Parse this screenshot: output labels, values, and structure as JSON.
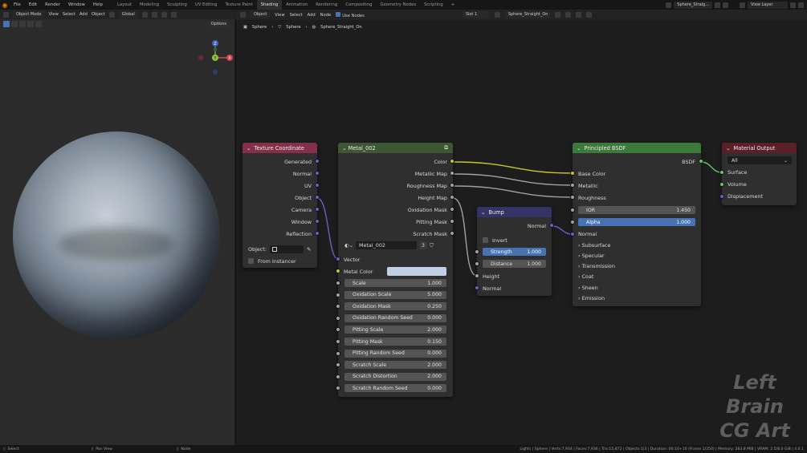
{
  "topbar": {
    "menus": [
      "File",
      "Edit",
      "Render",
      "Window",
      "Help"
    ],
    "workspaces": [
      "Layout",
      "Modeling",
      "Sculpting",
      "UV Editing",
      "Texture Paint",
      "Shading",
      "Animation",
      "Rendering",
      "Compositing",
      "Geometry Nodes",
      "Scripting"
    ],
    "active_workspace": "Shading",
    "plus": "+",
    "scene_name": "Sphere_Straig...",
    "view_layer": "View Layer"
  },
  "viewport": {
    "mode": "Object Mode",
    "menus": [
      "View",
      "Select",
      "Add",
      "Object"
    ],
    "transform": "Global",
    "options": "Options",
    "gizmo": {
      "z": "Z",
      "y": "Y",
      "x": "X"
    }
  },
  "node_editor": {
    "type": "Object",
    "menus": [
      "View",
      "Select",
      "Add",
      "Node"
    ],
    "use_nodes": "Use Nodes",
    "slot": "Slot 1",
    "material": "Sphere_Straight_On",
    "breadcrumb": [
      "Sphere",
      "Sphere",
      "Sphere_Straight_On"
    ]
  },
  "nodes": {
    "texcoord": {
      "title": "Texture Coordinate",
      "outputs": [
        "Generated",
        "Normal",
        "UV",
        "Object",
        "Camera",
        "Window",
        "Reflection"
      ],
      "object_label": "Object:",
      "from_instancer": "From Instancer"
    },
    "metal": {
      "title": "Metal_002",
      "outputs": [
        "Color",
        "Metallic Map",
        "Roughness Map",
        "Height Map",
        "Oxidation Mask",
        "Pitting Mask",
        "Scratch Mask"
      ],
      "group_name": "Metal_002",
      "group_users": "3",
      "vector": "Vector",
      "metal_color": "Metal Color",
      "metal_color_value": "#bfd0e6",
      "fields": [
        {
          "label": "Scale",
          "value": "1.000"
        },
        {
          "label": "Oxidation Scale",
          "value": "5.000"
        },
        {
          "label": "Oxidation Mask",
          "value": "0.250"
        },
        {
          "label": "Oxidation Random Seed",
          "value": "0.000"
        },
        {
          "label": "Pitting Scale",
          "value": "2.000"
        },
        {
          "label": "Pitting Mask",
          "value": "0.150"
        },
        {
          "label": "Pitting Random Seed",
          "value": "0.000"
        },
        {
          "label": "Scratch Scale",
          "value": "2.000"
        },
        {
          "label": "Scratch Distortion",
          "value": "2.000"
        },
        {
          "label": "Scratch Random Seed",
          "value": "0.000"
        }
      ]
    },
    "bump": {
      "title": "Bump",
      "output": "Normal",
      "invert": "Invert",
      "strength": {
        "label": "Strength",
        "value": "1.000"
      },
      "distance": {
        "label": "Distance",
        "value": "1.000"
      },
      "inputs": [
        "Height",
        "Normal"
      ]
    },
    "bsdf": {
      "title": "Principled BSDF",
      "output": "BSDF",
      "inputs": [
        "Base Color",
        "Metallic",
        "Roughness"
      ],
      "ior": {
        "label": "IOR",
        "value": "1.450"
      },
      "alpha": {
        "label": "Alpha",
        "value": "1.000"
      },
      "normal": "Normal",
      "panels": [
        "Subsurface",
        "Specular",
        "Transmission",
        "Coat",
        "Sheen",
        "Emission"
      ]
    },
    "output": {
      "title": "Material Output",
      "target": "All",
      "inputs": [
        "Surface",
        "Volume",
        "Displacement"
      ]
    }
  },
  "watermark": {
    "line1": "Left Brain",
    "line2": "CG Art"
  },
  "statusbar": {
    "left": [
      "Select",
      "Pan View",
      "Node"
    ],
    "right": "Lights | Sphere | Verts:7,934 | Faces:7,936 | Tris:15,872 | Objects:1/3 | Duration: 00:10+10 (Frame 1/250) | Memory: 283.8 MiB | VRAM: 2.5/8.0 GiB | 4.0.1"
  },
  "colors": {
    "texcoord_header": "#83314a",
    "metal_header": "#3c5731",
    "bump_header": "#333366",
    "bsdf_header": "#3c7a3c",
    "output_header": "#5b1f28",
    "sock_color": "#c7c729",
    "sock_float": "#a1a1a1",
    "sock_vector": "#6363c7",
    "sock_shader": "#63c763",
    "accent": "#4772b3"
  }
}
